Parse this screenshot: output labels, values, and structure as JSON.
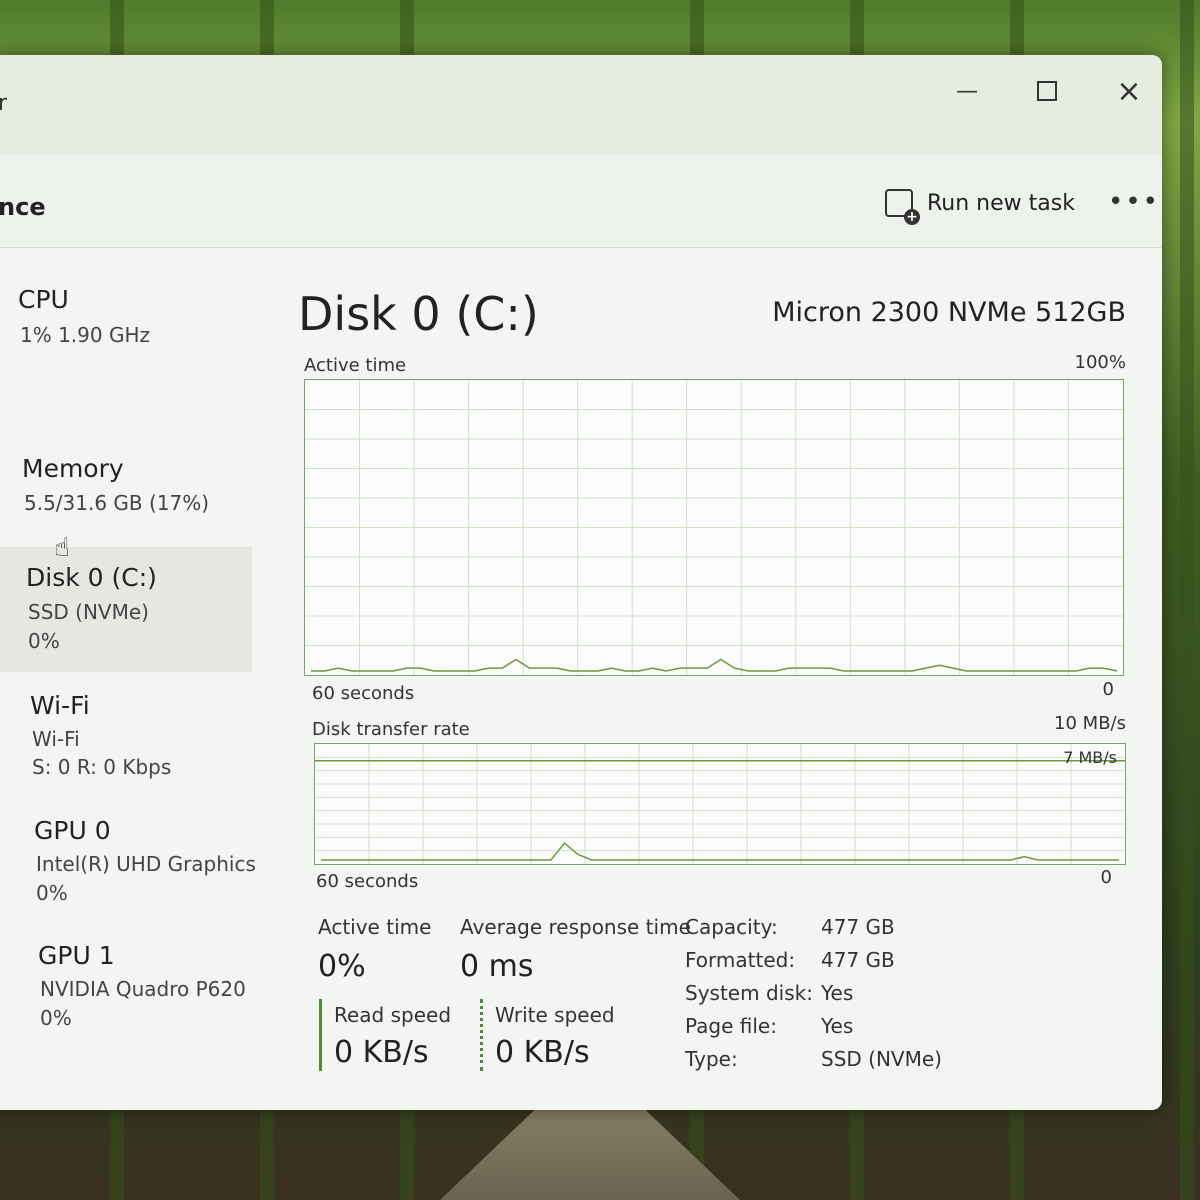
{
  "window": {
    "title_fragment": "r"
  },
  "toolbar": {
    "section_title": "nce",
    "run_task_label": "Run new task",
    "more_label": "•••"
  },
  "sidebar": {
    "items": [
      {
        "name": "CPU",
        "line1": "1%  1.90 GHz",
        "line2": ""
      },
      {
        "name": "Memory",
        "line1": "5.5/31.6 GB (17%)",
        "line2": ""
      },
      {
        "name": "Disk 0 (C:)",
        "line1": "SSD (NVMe)",
        "line2": "0%"
      },
      {
        "name": "Wi-Fi",
        "line1": "Wi-Fi",
        "line2": "S: 0  R: 0 Kbps"
      },
      {
        "name": "GPU 0",
        "line1": "Intel(R) UHD Graphics",
        "line2": "0%"
      },
      {
        "name": "GPU 1",
        "line1": "NVIDIA Quadro P620",
        "line2": "0%"
      }
    ]
  },
  "main": {
    "title": "Disk 0 (C:)",
    "model": "Micron 2300 NVMe 512GB",
    "active_graph": {
      "label": "Active time",
      "max": "100%",
      "min": "0",
      "duration": "60 seconds",
      "series": [
        0,
        0,
        1,
        0,
        0,
        0,
        0,
        1,
        1,
        0,
        0,
        0,
        0,
        1,
        1,
        4,
        1,
        1,
        1,
        0,
        0,
        0,
        1,
        0,
        0,
        1,
        0,
        1,
        1,
        1,
        4,
        1,
        0,
        0,
        0,
        1,
        1,
        1,
        1,
        0,
        0,
        0,
        0,
        0,
        0,
        1,
        2,
        1,
        0,
        0,
        0,
        0,
        0,
        0,
        0,
        0,
        0,
        1,
        1,
        0
      ]
    },
    "transfer_graph": {
      "label": "Disk transfer rate",
      "max": "10 MB/s",
      "level": "7 MB/s",
      "min": "0",
      "duration": "60 seconds",
      "series": [
        0,
        0,
        0,
        0,
        0,
        0,
        0,
        0,
        0,
        0,
        0,
        0,
        0,
        0,
        0,
        0,
        0,
        0,
        1.5,
        0.5,
        0,
        0,
        0,
        0,
        0,
        0,
        0,
        0,
        0,
        0,
        0,
        0,
        0,
        0,
        0,
        0,
        0,
        0,
        0,
        0,
        0,
        0,
        0,
        0,
        0,
        0,
        0,
        0,
        0,
        0,
        0,
        0,
        0.3,
        0,
        0,
        0,
        0,
        0,
        0,
        0
      ]
    },
    "stats": {
      "active_time_label": "Active time",
      "active_time_value": "0%",
      "avg_response_label": "Average response time",
      "avg_response_value": "0 ms",
      "read_label": "Read speed",
      "read_value": "0 KB/s",
      "write_label": "Write speed",
      "write_value": "0 KB/s"
    },
    "properties": [
      {
        "key": "Capacity:",
        "value": "477 GB"
      },
      {
        "key": "Formatted:",
        "value": "477 GB"
      },
      {
        "key": "System disk:",
        "value": "Yes"
      },
      {
        "key": "Page file:",
        "value": "Yes"
      },
      {
        "key": "Type:",
        "value": "SSD (NVMe)"
      }
    ]
  },
  "colors": {
    "graph_line": "#6a9a3a",
    "graph_grid": "#cfe0c8",
    "accent": "#4e8a3a"
  }
}
